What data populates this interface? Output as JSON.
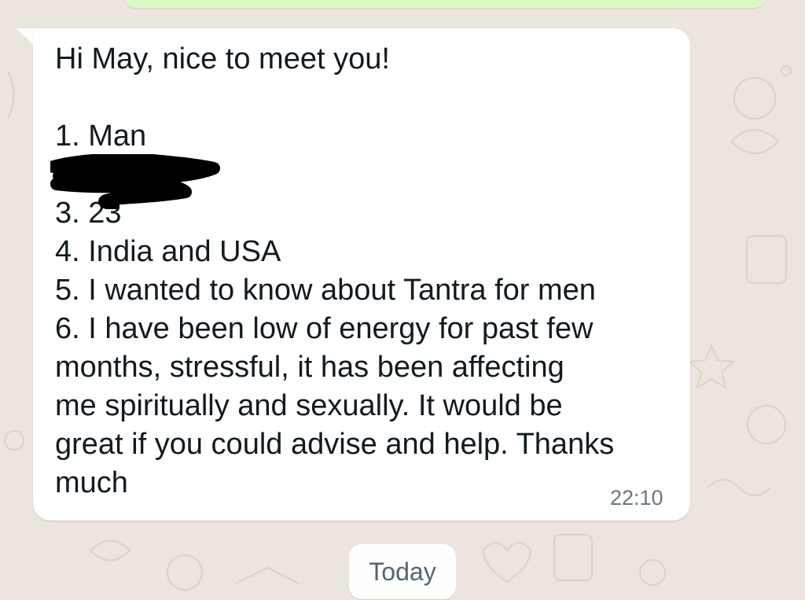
{
  "chat": {
    "message": {
      "lines": [
        "Hi May, nice to meet you!",
        "",
        "1. Man",
        "",
        "3. 23",
        "4. India and USA",
        "5. I wanted to know about Tantra for men",
        "6. I have been low of energy for past few",
        "months, stressful, it has been affecting",
        "me spiritually and sexually. It would be",
        "great if you could advise and help. Thanks",
        "much"
      ],
      "time": "22:10"
    },
    "date_divider": "Today"
  },
  "colors": {
    "wallpaper": "#ece5dd",
    "incoming_bubble": "#ffffff",
    "outgoing_bubble": "#dcf8c6",
    "timestamp": "#667781",
    "redaction": "#000000"
  },
  "icons": [
    "wallpaper-doodle-pattern"
  ]
}
